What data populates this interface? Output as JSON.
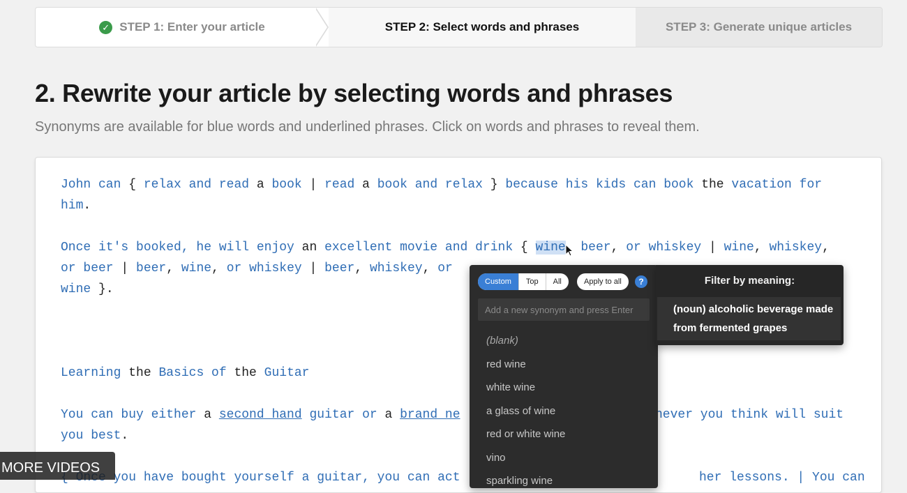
{
  "steps": [
    {
      "label": "STEP 1: Enter your article",
      "done": true
    },
    {
      "label": "STEP 2: Select words and phrases",
      "current": true
    },
    {
      "label": "STEP 3: Generate unique articles"
    }
  ],
  "title": "2. Rewrite your article by selecting words and phrases",
  "subtitle": "Synonyms are available for blue words and underlined phrases. Click on words and phrases to reveal them.",
  "article": {
    "p1_line1": [
      {
        "t": "John can",
        "s": "b"
      },
      {
        "t": " { ",
        "s": ""
      },
      {
        "t": "relax and read",
        "s": "b"
      },
      {
        "t": " a ",
        "s": ""
      },
      {
        "t": "book",
        "s": "b"
      },
      {
        "t": " | ",
        "s": ""
      },
      {
        "t": "read",
        "s": "b"
      },
      {
        "t": " a ",
        "s": ""
      },
      {
        "t": "book and relax",
        "s": "b"
      },
      {
        "t": " } ",
        "s": ""
      },
      {
        "t": "because his kids can book",
        "s": "b"
      },
      {
        "t": " the ",
        "s": ""
      },
      {
        "t": "vacation for",
        "s": "b"
      }
    ],
    "p1_line2": [
      {
        "t": "him",
        "s": "b"
      },
      {
        "t": ".",
        "s": ""
      }
    ],
    "p2_line1": [
      {
        "t": "Once it's booked, he will enjoy",
        "s": "b"
      },
      {
        "t": " an ",
        "s": ""
      },
      {
        "t": "excellent movie and drink",
        "s": "b"
      },
      {
        "t": " { ",
        "s": ""
      },
      {
        "t": "wine",
        "s": "hl"
      },
      {
        "t": ", ",
        "s": ""
      },
      {
        "t": "beer",
        "s": "b"
      },
      {
        "t": ", ",
        "s": ""
      },
      {
        "t": "or whiskey",
        "s": "b"
      },
      {
        "t": " | ",
        "s": ""
      },
      {
        "t": "wine",
        "s": "b"
      },
      {
        "t": ", ",
        "s": ""
      },
      {
        "t": "whiskey",
        "s": "b"
      },
      {
        "t": ",",
        "s": ""
      }
    ],
    "p2_line2": [
      {
        "t": "or beer",
        "s": "b"
      },
      {
        "t": " | ",
        "s": ""
      },
      {
        "t": "beer",
        "s": "b"
      },
      {
        "t": ", ",
        "s": ""
      },
      {
        "t": "wine",
        "s": "b"
      },
      {
        "t": ", ",
        "s": ""
      },
      {
        "t": "or whiskey",
        "s": "b"
      },
      {
        "t": " | ",
        "s": ""
      },
      {
        "t": "beer",
        "s": "b"
      },
      {
        "t": ", ",
        "s": ""
      },
      {
        "t": "whiskey",
        "s": "b"
      },
      {
        "t": ", ",
        "s": ""
      },
      {
        "t": "or",
        "s": "b"
      }
    ],
    "p2_line3": [
      {
        "t": "wine",
        "s": "b"
      },
      {
        "t": " }.",
        "s": ""
      }
    ],
    "h_line": [
      {
        "t": "Learning",
        "s": "b"
      },
      {
        "t": " the ",
        "s": ""
      },
      {
        "t": "Basics of",
        "s": "b"
      },
      {
        "t": " the ",
        "s": ""
      },
      {
        "t": "Guitar",
        "s": "b"
      }
    ],
    "p3_line1_left": [
      {
        "t": "You can buy either",
        "s": "b"
      },
      {
        "t": " a ",
        "s": ""
      },
      {
        "t": "second hand",
        "s": "u"
      },
      {
        "t": " ",
        "s": ""
      },
      {
        "t": "guitar or",
        "s": "b"
      },
      {
        "t": " a ",
        "s": ""
      },
      {
        "t": "brand ne",
        "s": "u"
      }
    ],
    "p3_line1_right": [
      {
        "t": "never you think will suit",
        "s": "b"
      }
    ],
    "p3_line2": [
      {
        "t": "you best",
        "s": "b"
      },
      {
        "t": ".",
        "s": ""
      }
    ],
    "p4_line1": [
      {
        "t": "{ Once you have bought yourself a guitar, you can act",
        "s": "b"
      }
    ],
    "p4_line1_right": [
      {
        "t": "her lessons. | You can",
        "s": "b"
      }
    ]
  },
  "popup": {
    "toggle": [
      "Custom",
      "Top",
      "All"
    ],
    "apply_all": "Apply to all",
    "help": "?",
    "input_placeholder": "Add a new synonym and press Enter",
    "synonyms": [
      "(blank)",
      "red wine",
      "white wine",
      "a glass of wine",
      "red or white wine",
      "vino",
      "sparkling wine"
    ],
    "filter_title": "Filter by meaning:",
    "meaning_line1": "(noun) alcoholic beverage made",
    "meaning_line2": "from fermented grapes"
  },
  "overlay": {
    "more_videos": "MORE VIDEOS"
  },
  "colors": {
    "link_blue": "#2f6db5",
    "accent": "#3a7fd5",
    "check_green": "#3a9b4a"
  }
}
